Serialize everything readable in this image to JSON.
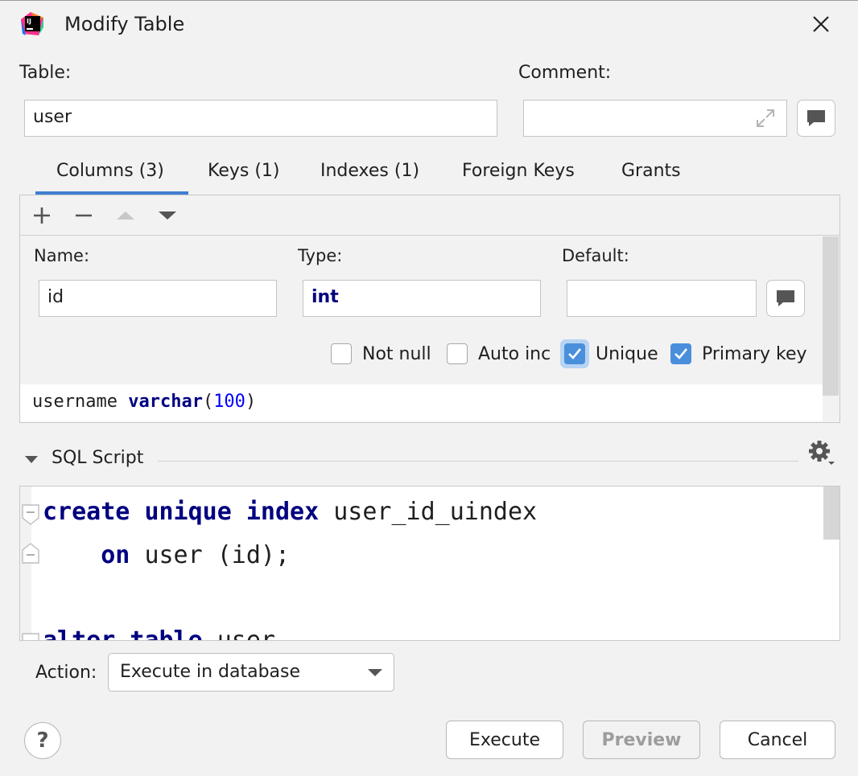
{
  "window": {
    "title": "Modify Table"
  },
  "table_label": "Table:",
  "table_value": "user",
  "comment_label": "Comment:",
  "comment_value": "",
  "tabs": [
    "Columns (3)",
    "Keys (1)",
    "Indexes (1)",
    "Foreign Keys",
    "Grants"
  ],
  "active_tab": "Columns (3)",
  "column_editor": {
    "name_label": "Name:",
    "type_label": "Type:",
    "default_label": "Default:",
    "name_value": "id",
    "type_value": "int",
    "default_value": "",
    "checkboxes": [
      {
        "label": "Not null",
        "checked": false
      },
      {
        "label": "Auto inc",
        "checked": false
      },
      {
        "label": "Unique",
        "checked": true
      },
      {
        "label": "Primary key",
        "checked": true
      }
    ]
  },
  "next_column": {
    "name": "username",
    "type": "varchar",
    "open": "(",
    "size": "100",
    "close": ")"
  },
  "sql_section": {
    "label": "SQL Script",
    "lines": [
      {
        "kw1": "create",
        "kw2": "unique",
        "kw3": "index",
        "rest": "user_id_uindex"
      },
      {
        "kw1": "on",
        "rest": "user (id);"
      },
      {
        "kw1": "alter",
        "kw2": "table",
        "rest": "user"
      }
    ]
  },
  "action": {
    "label": "Action:",
    "value": "Execute in database"
  },
  "buttons": {
    "execute": "Execute",
    "preview": "Preview",
    "cancel": "Cancel",
    "help": "?"
  },
  "colors": {
    "accent": "#3f7fd0",
    "checkbox": "#4a8fdc",
    "keyword": "#000080",
    "number": "#0000ff"
  }
}
